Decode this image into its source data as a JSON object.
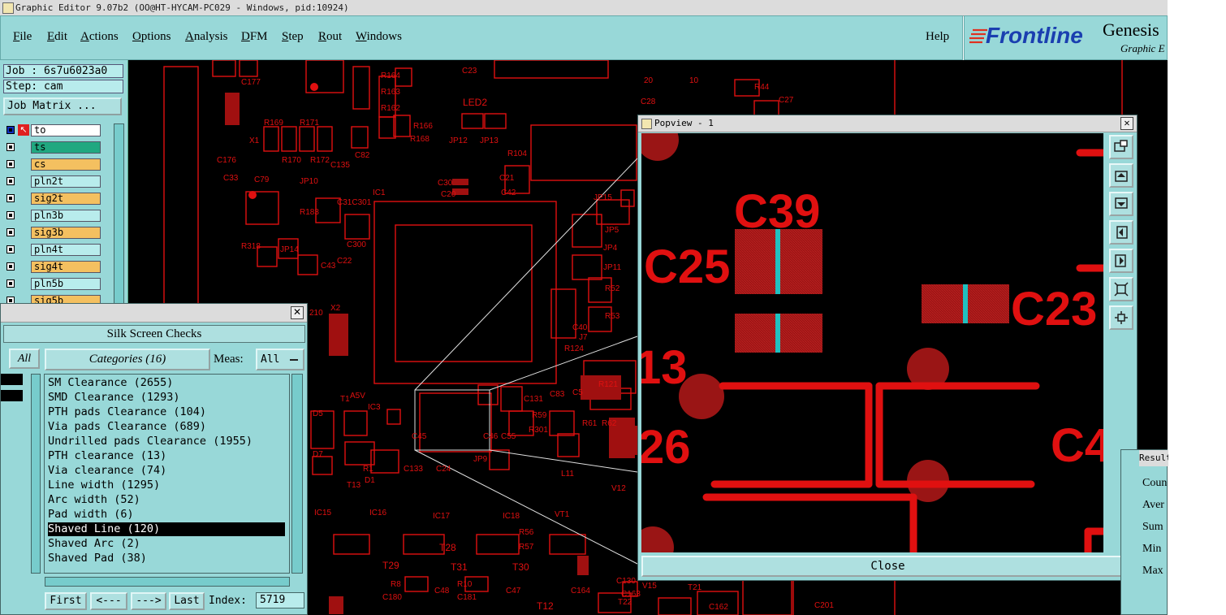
{
  "window": {
    "title": "Graphic Editor 9.07b2 (OO@HT-HYCAM-PC029 - Windows, pid:10924)"
  },
  "menubar": {
    "items": [
      {
        "label": "File",
        "u": "F",
        "rest": "ile"
      },
      {
        "label": "Edit",
        "u": "E",
        "rest": "dit"
      },
      {
        "label": "Actions",
        "u": "A",
        "rest": "ctions"
      },
      {
        "label": "Options",
        "u": "O",
        "rest": "ptions"
      },
      {
        "label": "Analysis",
        "u": "A",
        "rest": "nalysis"
      },
      {
        "label": "DFM",
        "u": "D",
        "rest": "FM"
      },
      {
        "label": "Step",
        "u": "S",
        "rest": "tep"
      },
      {
        "label": "Rout",
        "u": "R",
        "rest": "out"
      },
      {
        "label": "Windows",
        "u": "W",
        "rest": "indows"
      }
    ],
    "help": "Help"
  },
  "logo": {
    "brand": "Frontline",
    "product": "Genesis",
    "subtitle": "Graphic E"
  },
  "left": {
    "job": "Job : 6s7u6023a0",
    "step": "Step: cam",
    "job_matrix": "Job Matrix ...",
    "layers": [
      {
        "name": "to",
        "color": "#ffffff",
        "active": true
      },
      {
        "name": "ts",
        "color": "#20a880"
      },
      {
        "name": "cs",
        "color": "#f4c060"
      },
      {
        "name": "pln2t",
        "color": "#b8ecec"
      },
      {
        "name": "sig2t",
        "color": "#f4c060"
      },
      {
        "name": "pln3b",
        "color": "#b8ecec"
      },
      {
        "name": "sig3b",
        "color": "#f4c060"
      },
      {
        "name": "pln4t",
        "color": "#b8ecec"
      },
      {
        "name": "sig4t",
        "color": "#f4c060"
      },
      {
        "name": "pln5b",
        "color": "#b8ecec"
      },
      {
        "name": "sig5b",
        "color": "#f4c060"
      }
    ]
  },
  "silk": {
    "title": "Silk Screen Checks",
    "all_left": "All",
    "categories_btn": "Categories (16)",
    "meas_label": "Meas:",
    "meas_value": "All",
    "categories": [
      "SM Clearance (2655)",
      "SMD Clearance (1293)",
      "PTH pads Clearance (104)",
      "Via pads Clearance (689)",
      "Undrilled pads Clearance (1955)",
      "PTH clearance (13)",
      "Via clearance (74)",
      "Line width (1295)",
      "Arc width (52)",
      "Pad width (6)",
      "Shaved Line (120)",
      "Shaved Arc (2)",
      "Shaved Pad (38)"
    ],
    "selected_index": 10,
    "nav": {
      "first": "First",
      "prev": "<---",
      "next": "--->",
      "last": "Last",
      "index_label": "Index:",
      "index_value": "5719"
    }
  },
  "popview": {
    "title": "Popview - 1",
    "close": "Close",
    "labels": {
      "c39": "C39",
      "c25": "C25",
      "c23": "C23",
      "n13": "13",
      "n26": "26",
      "c4": "C4"
    }
  },
  "results": {
    "title": "Result",
    "rows": [
      "Coun",
      "Aver",
      "Sum",
      "Min",
      "Max"
    ]
  },
  "canvas_labels": {
    "led2": "LED2",
    "ic1": "IC1",
    "jp12": "JP12",
    "jp13": "JP13",
    "r104": "R104",
    "c30": "C30",
    "c20": "C20",
    "jp10": "JP10",
    "c31": "C31C301",
    "r183": "R183",
    "r318": "R318",
    "jp14": "JP14",
    "c43": "C43",
    "c22": "C22",
    "c300": "C300",
    "r169": "R169",
    "r171": "R171",
    "r170": "R170",
    "r172": "R172",
    "x1": "X1",
    "c176": "C176",
    "c177": "C177",
    "c33": "C33",
    "c79": "C79",
    "c82": "C82",
    "c135": "C135",
    "r166": "R166",
    "r168": "R168",
    "r164": "R164",
    "r163": "R163",
    "r162": "R162",
    "c23": "C23",
    "r44": "R44",
    "c27": "C27",
    "c28": "C28",
    "c21": "C21",
    "c42": "C42",
    "jp15": "JP15",
    "jp5": "JP5",
    "jp4": "JP4",
    "jp11": "JP11",
    "r52": "R52",
    "r53": "R53",
    "c40": "C40",
    "j7": "J7",
    "r124": "R124",
    "r121": "R121",
    "c131": "C131",
    "c83": "C83",
    "c5": "C5",
    "r59": "R59",
    "r301": "R301",
    "r61": "R61",
    "r62": "R62",
    "c55": "C55",
    "c46": "C46",
    "c45": "C45",
    "d5": "D5",
    "d7": "D7",
    "t1": "T1",
    "a5v": "A5V",
    "ic3": "IC3",
    "c133": "C133",
    "c24": "C24",
    "r1": "R1",
    "t13": "T13",
    "d1": "D1",
    "jp9": "JP9",
    "l11": "L11",
    "v12": "V12",
    "ic15": "IC15",
    "ic16": "IC16",
    "ic17": "IC17",
    "ic18": "IC18",
    "vt1": "VT1",
    "r56": "R56",
    "r57": "R57",
    "t28": "T28",
    "t29": "T29",
    "t31": "T31",
    "t30": "T30",
    "r8": "R8",
    "c180": "C180",
    "c48": "C48",
    "r10": "R10",
    "c181": "C181",
    "c47": "C47",
    "t12": "T12",
    "c164": "C164",
    "c130": "C130",
    "v15": "V15",
    "t21": "T21",
    "t22": "T22",
    "c163": "C163",
    "c162": "C162",
    "c201": "C201",
    "x2": "X2",
    "c10": "210",
    "n20": "20",
    "n10": "10"
  }
}
